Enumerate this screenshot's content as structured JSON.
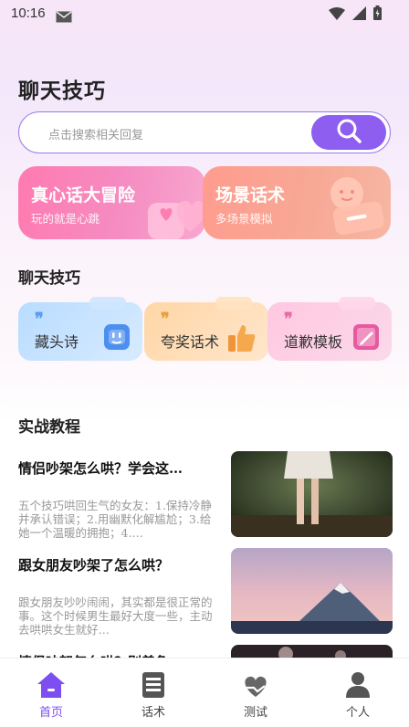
{
  "status": {
    "time": "10:16"
  },
  "page": {
    "title": "聊天技巧"
  },
  "search": {
    "placeholder": "点击搜索相关回复"
  },
  "cards": [
    {
      "title": "真心话大冒险",
      "subtitle": "玩的就是心跳"
    },
    {
      "title": "场景话术",
      "subtitle": "多场景模拟"
    }
  ],
  "tips_section": {
    "title": "聊天技巧",
    "items": [
      {
        "label": "藏头诗",
        "quote": "❞"
      },
      {
        "label": "夸奖话术",
        "quote": "❞"
      },
      {
        "label": "道歉模板",
        "quote": "❞"
      }
    ]
  },
  "tutorials": {
    "title": "实战教程",
    "articles": [
      {
        "title": "情侣吵架怎么哄？学会这…",
        "desc": "五个技巧哄回生气的女友：1.保持冷静并承认错误；2.用幽默化解尴尬；3.给她一个温暖的拥抱；4.…"
      },
      {
        "title": "跟女朋友吵架了怎么哄？",
        "desc": "跟女朋友吵吵闹闹，其实都是很正常的事。这个时候男生最好大度一些，主动去哄哄女生就好…"
      },
      {
        "title": "情侣吵架怎么哄？别着急…",
        "desc": ""
      }
    ]
  },
  "tabbar": [
    {
      "label": "首页",
      "icon": "home-icon",
      "active": true
    },
    {
      "label": "话术",
      "icon": "book-icon",
      "active": false
    },
    {
      "label": "测试",
      "icon": "heart-hand-icon",
      "active": false
    },
    {
      "label": "个人",
      "icon": "person-icon",
      "active": false
    }
  ],
  "colors": {
    "accent": "#8d5ef0",
    "tab_active": "#7d4ef0"
  }
}
